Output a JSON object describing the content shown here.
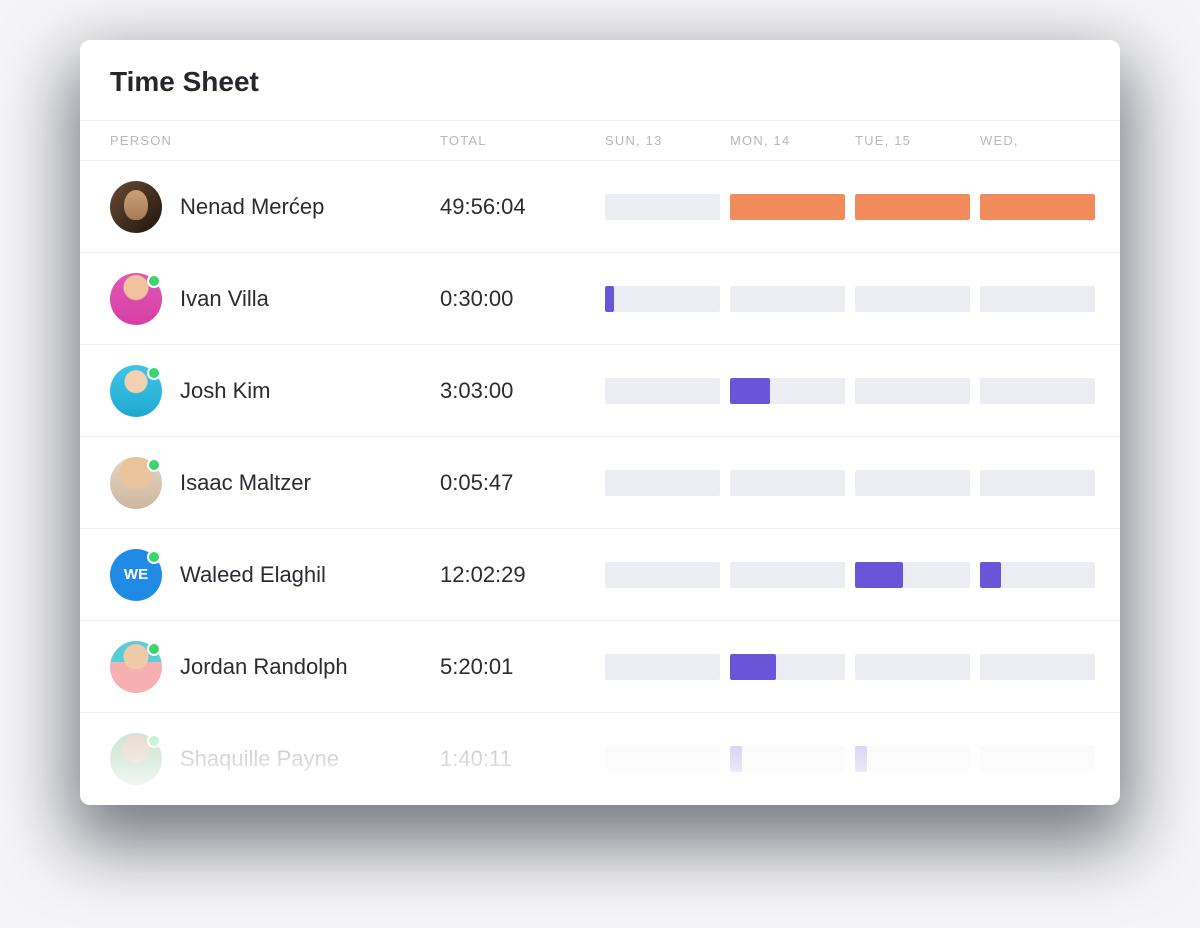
{
  "title": "Time Sheet",
  "columns": {
    "person": "PERSON",
    "total": "TOTAL",
    "days": [
      "SUN, 13",
      "MON, 14",
      "TUE, 15",
      "WED,"
    ]
  },
  "colors": {
    "orange": "#f18b5c",
    "purple": "#6a55d9",
    "track": "#ecedf2"
  },
  "rows": [
    {
      "name": "Nenad Merćep",
      "total": "49:56:04",
      "avatar_class": "av-brown",
      "online": false,
      "bars": [
        {
          "fill": 0,
          "color": "track"
        },
        {
          "fill": 100,
          "color": "orange"
        },
        {
          "fill": 100,
          "color": "orange"
        },
        {
          "fill": 100,
          "color": "orange"
        }
      ]
    },
    {
      "name": "Ivan Villa",
      "total": "0:30:00",
      "avatar_class": "av-magenta",
      "online": true,
      "bars": [
        {
          "fill": 8,
          "color": "purple"
        },
        {
          "fill": 0,
          "color": "track"
        },
        {
          "fill": 0,
          "color": "track"
        },
        {
          "fill": 0,
          "color": "track"
        }
      ]
    },
    {
      "name": "Josh Kim",
      "total": "3:03:00",
      "avatar_class": "av-cyan",
      "online": true,
      "bars": [
        {
          "fill": 0,
          "color": "track"
        },
        {
          "fill": 35,
          "color": "purple"
        },
        {
          "fill": 0,
          "color": "track"
        },
        {
          "fill": 0,
          "color": "track"
        }
      ]
    },
    {
      "name": "Isaac Maltzer",
      "total": "0:05:47",
      "avatar_class": "av-tan",
      "online": true,
      "bars": [
        {
          "fill": 0,
          "color": "track"
        },
        {
          "fill": 0,
          "color": "track"
        },
        {
          "fill": 0,
          "color": "track"
        },
        {
          "fill": 0,
          "color": "track"
        }
      ]
    },
    {
      "name": "Waleed Elaghil",
      "total": "12:02:29",
      "avatar_class": "av-blue-flat",
      "avatar_initials": "WE",
      "online": true,
      "bars": [
        {
          "fill": 0,
          "color": "track"
        },
        {
          "fill": 0,
          "color": "track"
        },
        {
          "fill": 42,
          "color": "purple"
        },
        {
          "fill": 18,
          "color": "purple"
        }
      ]
    },
    {
      "name": "Jordan Randolph",
      "total": "5:20:01",
      "avatar_class": "av-pink",
      "online": true,
      "bars": [
        {
          "fill": 0,
          "color": "track"
        },
        {
          "fill": 40,
          "color": "purple"
        },
        {
          "fill": 0,
          "color": "track"
        },
        {
          "fill": 0,
          "color": "track"
        }
      ]
    },
    {
      "name": "Shaquille Payne",
      "total": "1:40:11",
      "avatar_class": "av-green",
      "online": true,
      "faded": true,
      "bars": [
        {
          "fill": 0,
          "color": "track"
        },
        {
          "fill": 10,
          "color": "purple"
        },
        {
          "fill": 10,
          "color": "purple"
        },
        {
          "fill": 0,
          "color": "track"
        }
      ]
    }
  ]
}
